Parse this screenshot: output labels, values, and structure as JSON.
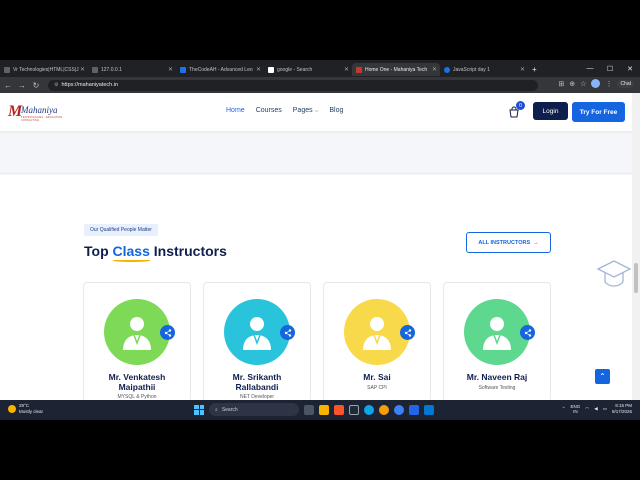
{
  "browser": {
    "tabs": [
      {
        "label": "Vr Technologies|HTML|CSS|J",
        "active": false
      },
      {
        "label": "127.0.0.1",
        "active": false
      },
      {
        "label": "TheCodeAH - Advanced Leo",
        "active": false
      },
      {
        "label": "google - Search",
        "active": false
      },
      {
        "label": "Home One - Mahaniya Tech",
        "active": true
      },
      {
        "label": "JavaScript day 1",
        "active": false
      }
    ],
    "url": "https://mahaniyatech.in",
    "chat_label": "Chat"
  },
  "site": {
    "logo_text": "Mahaniya",
    "logo_tagline": "TECHNOLOGIES · EDUCATION · CONSULTING",
    "nav": [
      "Home",
      "Courses",
      "Pages",
      "Blog"
    ],
    "cart_count": "0",
    "login_label": "Login",
    "try_label": "Try For Free"
  },
  "instructors_section": {
    "pill": "Our Qualified People Matter",
    "heading_pre": "Top ",
    "heading_hl": "Class",
    "heading_post": " Instructors",
    "all_button": "ALL INSTRUCTORS",
    "cards": [
      {
        "name_line1": "Mr. Venkatesh",
        "name_line2": "Maipathii",
        "role": "MYSQL & Python",
        "color": "#7ed957"
      },
      {
        "name_line1": "Mr. Srikanth",
        "name_line2": "Rallabandi",
        "role": "NET Developer",
        "color": "#29c4dc"
      },
      {
        "name_line1": "Mr. Sai",
        "name_line2": "",
        "role": "SAP CPI",
        "color": "#f8d94a"
      },
      {
        "name_line1": "Mr. Naveen Raj",
        "name_line2": "",
        "role": "Software Testing",
        "color": "#5fd88f"
      }
    ]
  },
  "taskbar": {
    "temp": "29°C",
    "weather": "Mostly clear",
    "search_label": "Search",
    "lang1": "ENG",
    "lang2": "IN",
    "time": "9:15 PM",
    "date": "9/17/2026"
  }
}
